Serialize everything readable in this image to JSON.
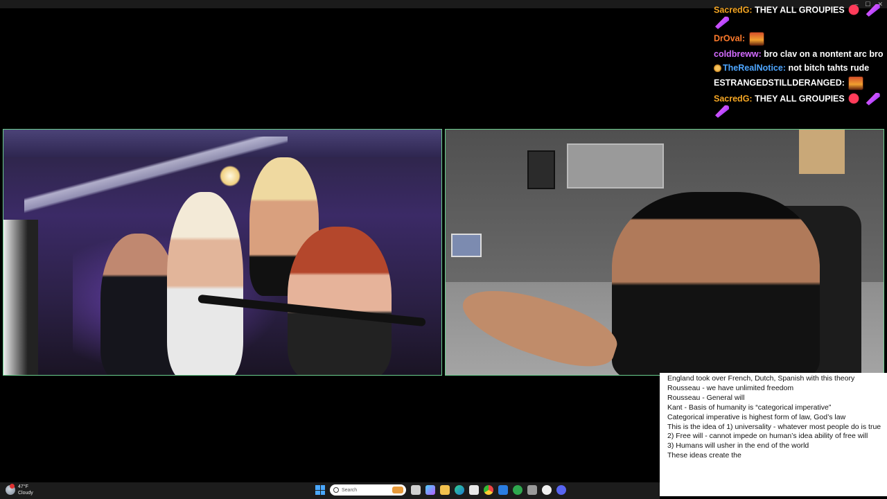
{
  "chat": {
    "messages": [
      {
        "user": "SacredG",
        "color": "#f5a623",
        "text": "THEY ALL GROUPIES",
        "emotes": [
          "shoe-emote",
          "rocket-emote",
          "rocket-emote"
        ]
      },
      {
        "user": "DrOval",
        "color": "#ff7b2c",
        "text": "",
        "emotes": [
          "face-emote"
        ]
      },
      {
        "user": "coldbreww",
        "color": "#d36bff",
        "text": "bro clav on a nontent arc bro",
        "emotes": []
      },
      {
        "user": "TheRealNotice",
        "color": "#4ea6ff",
        "text": "not bitch tahts rude",
        "emotes": [],
        "badge": true
      },
      {
        "user": "ESTRANGEDSTILLDERANGED",
        "color": "#ffffff",
        "text": "",
        "emotes": [
          "face-emote"
        ]
      },
      {
        "user": "SacredG",
        "color": "#f5a623",
        "text": "THEY ALL GROUPIES",
        "emotes": [
          "shoe-emote",
          "rocket-emote",
          "rocket-emote"
        ]
      }
    ]
  },
  "notes": {
    "lines": [
      "England took over French, Dutch, Spanish with this theory",
      "Rousseau - we have unlimited freedom",
      "Rousseau - General will",
      "Kant - Basis of humanity is “categorical imperative”",
      "Categorical imperative is highest form of law, God’s law",
      "This is the idea of 1) universality - whatever most people do is true",
      "2) Free will - cannot impede on human’s idea ability of free will",
      "3) Humans will usher in the end of the world",
      "These ideas create the"
    ]
  },
  "taskbar": {
    "weather_temp": "47°F",
    "weather_desc": "Cloudy",
    "search_placeholder": "Search",
    "icons": [
      "windows-start-icon",
      "search-icon",
      "task-view-icon",
      "copilot-icon",
      "file-explorer-icon",
      "edge-icon",
      "store-icon",
      "chrome-icon",
      "vscode-icon",
      "xbox-icon",
      "photos-icon",
      "github-icon",
      "discord-icon"
    ]
  },
  "colors": {
    "video_border": "#6bd08f",
    "background": "#000000",
    "notes_bg": "#ffffff"
  }
}
